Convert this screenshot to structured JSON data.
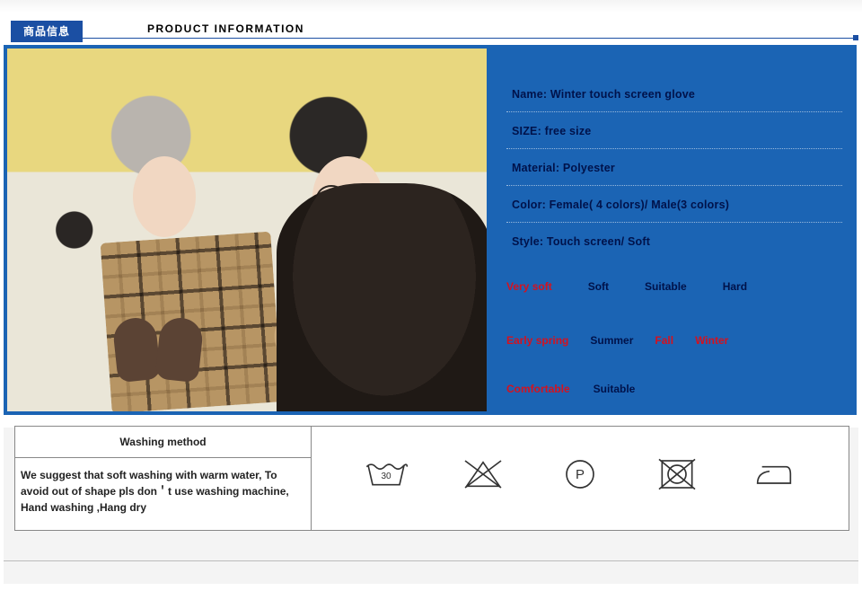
{
  "header": {
    "tab_cn": "商品信息",
    "title_en": "PRODUCT INFORMATION"
  },
  "specs": {
    "name": "Name: Winter touch screen glove",
    "size": "SIZE: free size",
    "material": "Material: Polyester",
    "color": "Color: Female( 4 colors)/ Male(3 colors)",
    "style": "Style: Touch screen/ Soft"
  },
  "softness": {
    "very_soft": "Very soft",
    "soft": "Soft",
    "suitable": "Suitable",
    "hard": "Hard"
  },
  "season": {
    "early_spring": "Early spring",
    "summer": "Summer",
    "fall": "Fall",
    "winter": "Winter"
  },
  "comfort": {
    "comfortable": "Comfortable",
    "suitable": "Suitable"
  },
  "washing": {
    "header": "Washing method",
    "body": "We suggest that soft washing with warm water, To avoid out of shape pls don＇t use washing machine, Hand washing ,Hang dry"
  },
  "care_icons": [
    "wash-30-icon",
    "do-not-bleach-icon",
    "dry-clean-p-icon",
    "do-not-tumble-dry-icon",
    "iron-icon"
  ]
}
